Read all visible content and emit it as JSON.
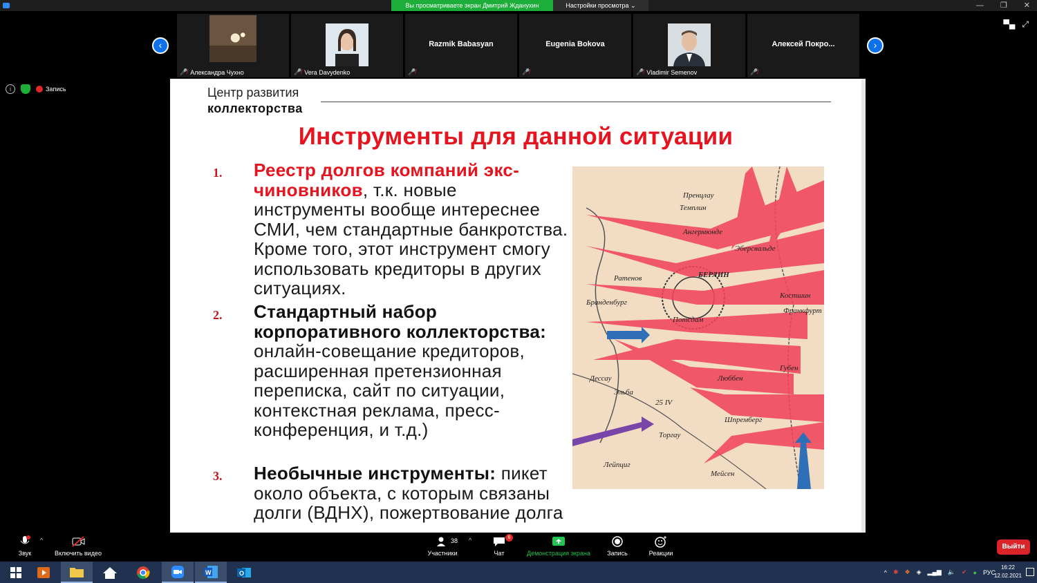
{
  "banner": {
    "sharing_text": "Вы просматриваете экран Дмитрий Жданухин",
    "settings_label": "Настройки просмотра ⌄"
  },
  "window_controls": {
    "minimize": "—",
    "restore": "❐",
    "close": "✕"
  },
  "participants": [
    {
      "name": "Александра Чухно",
      "muted": true,
      "video": true
    },
    {
      "name": "Vera Davydenko",
      "muted": true,
      "video": true
    },
    {
      "name": "Razmik Babasyan",
      "muted": true,
      "video": false
    },
    {
      "name": "Eugenia Bokova",
      "muted": true,
      "video": false
    },
    {
      "name": "Vladimir Semenov",
      "muted": true,
      "video": true
    },
    {
      "name": "Алексей  Покро...",
      "muted": true,
      "video": false
    }
  ],
  "recording": {
    "label": "Запись"
  },
  "slide": {
    "brand_line1": "Центр развития",
    "brand_line2": "коллекторства",
    "title": "Инструменты для данной ситуации",
    "items": [
      {
        "num": "1.",
        "highlight": "Реестр долгов компаний экс-чиновников",
        "rest": ", т.к. новые инструменты вообще интереснее СМИ, чем стандартные банкротства. Кроме того, этот инструмент смогу использовать кредиторы в других ситуациях."
      },
      {
        "num": "2.",
        "highlight": "Стандартный набор корпоративного коллекторства:",
        "rest": " онлайн-совещание кредиторов, расширенная претензионная переписка, сайт по ситуации, контекстная реклама, пресс-конференция, и т.д.)"
      },
      {
        "num": "3.",
        "highlight": "Необычные инструменты:",
        "rest": " пикет около объекта, с которым связаны долги (ВДНХ), пожертвование долга"
      }
    ],
    "map_labels": [
      "Пренцлау",
      "Темплин",
      "Ангермюнде",
      "Эберсвальде",
      "Ратенов",
      "БЕРЛИН",
      "Бранденбург",
      "Костшин",
      "Потсдам",
      "Франкфурт",
      "Губен",
      "Дессау",
      "Эльба",
      "Люббен",
      "25 IV",
      "Торгау",
      "Шпремберг",
      "Лейпциг",
      "Мейсен"
    ]
  },
  "toolbar": {
    "audio": "Звук",
    "video": "Включить видео",
    "participants": "Участники",
    "participants_count": "38",
    "chat": "Чат",
    "chat_badge": "6",
    "share": "Демонстрация экрана",
    "record": "Запись",
    "reactions": "Реакции",
    "leave": "Выйти"
  },
  "taskbar": {
    "language": "РУС",
    "time": "16:22",
    "date": "12.02.2021"
  },
  "colors": {
    "accent_red": "#e5141e",
    "zoom_blue": "#0e71eb",
    "share_green": "#1dae3a"
  }
}
